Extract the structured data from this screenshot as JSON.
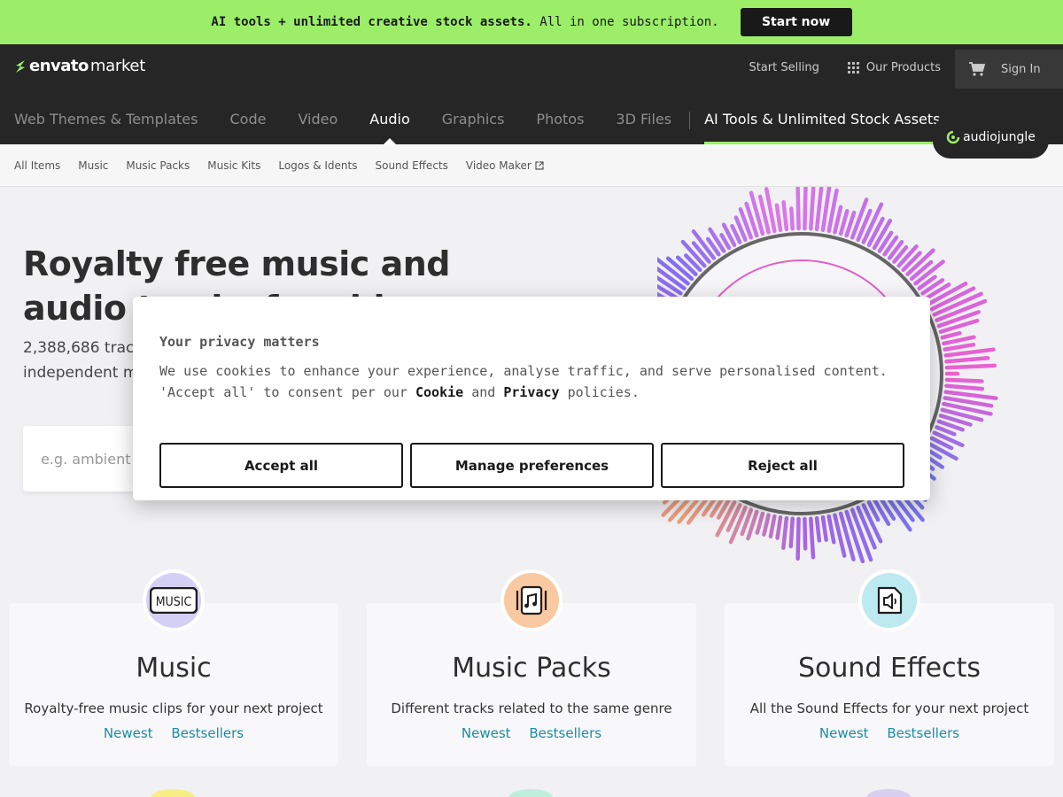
{
  "promo": {
    "text_bold": "AI tools + unlimited creative stock assets.",
    "text_rest": " All in one subscription.",
    "cta": "Start now",
    "bg_color": "#9cee69"
  },
  "header": {
    "logo_primary": "envato",
    "logo_secondary": "market",
    "start_selling": "Start Selling",
    "our_products": "Our Products",
    "sign_in": "Sign In",
    "categories": [
      {
        "label": "Web Themes & Templates"
      },
      {
        "label": "Code"
      },
      {
        "label": "Video"
      },
      {
        "label": "Audio"
      },
      {
        "label": "Graphics"
      },
      {
        "label": "Photos"
      },
      {
        "label": "3D Files"
      }
    ],
    "ai_category": "AI Tools & Unlimited Stock Assets",
    "active_category": "Audio",
    "site_badge": "audiojungle"
  },
  "subnav": {
    "items": [
      "All Items",
      "Music",
      "Music Packs",
      "Music Kits",
      "Logos & Idents",
      "Sound Effects",
      "Video Maker"
    ]
  },
  "hero": {
    "title": "Royalty free music and audio tracks for video",
    "subtitle": "2,388,686 tracks and sounds from our global community of independent musicians and sound engineers.",
    "search_placeholder": "e.g. ambient"
  },
  "cookie": {
    "title": "Your privacy matters",
    "body_before": "We use cookies to enhance your experience, analyse traffic, and serve personalised content. 'Accept all' to consent per our ",
    "cookie_link": "Cookie",
    "body_and": " and ",
    "privacy_link": "Privacy",
    "body_after": " policies.",
    "accept": "Accept all",
    "manage": "Manage preferences",
    "reject": "Reject all"
  },
  "categories": [
    {
      "title": "Music",
      "desc": "Royalty-free music clips for your next project",
      "newest": "Newest",
      "bestsellers": "Bestsellers",
      "icon": "music-text-icon",
      "color": "#d4d0f5",
      "icon_text": "MUSIC"
    },
    {
      "title": "Music Packs",
      "desc": "Different tracks related to the same genre",
      "newest": "Newest",
      "bestsellers": "Bestsellers",
      "icon": "music-pack-icon",
      "color": "#f9c9a1"
    },
    {
      "title": "Sound Effects",
      "desc": "All the Sound Effects for your next project",
      "newest": "Newest",
      "bestsellers": "Bestsellers",
      "icon": "sound-file-icon",
      "color": "#bde9f0"
    }
  ]
}
